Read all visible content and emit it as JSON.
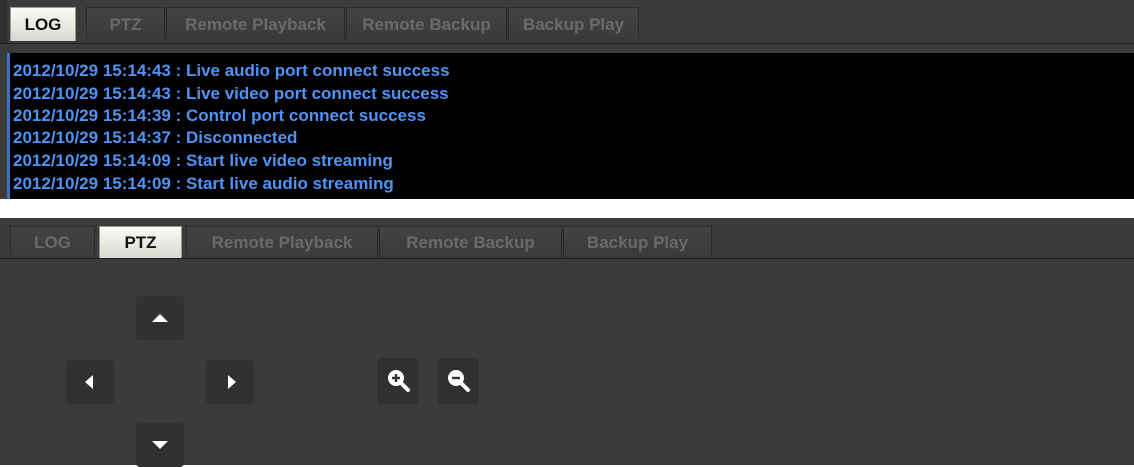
{
  "log_panel": {
    "tabs": [
      {
        "label": "LOG",
        "active": true
      },
      {
        "label": "PTZ",
        "active": false
      },
      {
        "label": "Remote Playback",
        "active": false
      },
      {
        "label": "Remote Backup",
        "active": false
      },
      {
        "label": "Backup Play",
        "active": false
      }
    ],
    "entries": [
      "2012/10/29 15:14:43 : Live audio port connect success",
      "2012/10/29 15:14:43 : Live video port connect success",
      "2012/10/29 15:14:39 : Control port connect success",
      "2012/10/29 15:14:37 : Disconnected",
      "2012/10/29 15:14:09 : Start live video streaming",
      "2012/10/29 15:14:09 : Start live audio streaming"
    ],
    "text_color": "#4f93f5"
  },
  "ptz_panel": {
    "tabs": [
      {
        "label": "LOG",
        "active": false
      },
      {
        "label": "PTZ",
        "active": true
      },
      {
        "label": "Remote Playback",
        "active": false
      },
      {
        "label": "Remote Backup",
        "active": false
      },
      {
        "label": "Backup Play",
        "active": false
      }
    ],
    "controls": {
      "up": "arrow-up-icon",
      "left": "arrow-left-icon",
      "right": "arrow-right-icon",
      "down": "arrow-down-icon",
      "zoom_in": "zoom-in-icon",
      "zoom_out": "zoom-out-icon"
    }
  }
}
